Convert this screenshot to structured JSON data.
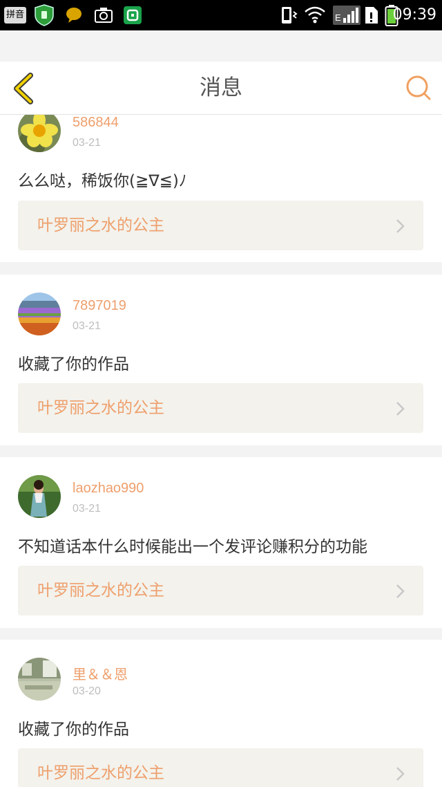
{
  "status_bar": {
    "time": "09:39",
    "ime_label": "拼音",
    "icons": [
      "ime-icon",
      "shield-app-icon",
      "chat-bubble-icon",
      "camera-icon",
      "green-app-icon",
      "vibrate-icon",
      "wifi-icon",
      "signal-icon",
      "sim-icon",
      "battery-icon"
    ],
    "network_type": "E"
  },
  "nav": {
    "title": "消息",
    "back_icon": "chevron-left-icon",
    "search_icon": "search-icon",
    "accent_color": "#f0a060",
    "back_color": "#e8c200"
  },
  "messages": [
    {
      "username": "586844",
      "date": "03-21",
      "text": "么么哒，稀饭你(≧∇≦)ﾉ",
      "work_title": "叶罗丽之水的公主",
      "avatar": "flower-avatar"
    },
    {
      "username": "7897019",
      "date": "03-21",
      "text": "收藏了你的作品",
      "work_title": "叶罗丽之水的公主",
      "avatar": "field-avatar"
    },
    {
      "username": "laozhao990",
      "date": "03-21",
      "text": "不知道话本什么时候能出一个发评论赚积分的功能",
      "work_title": "叶罗丽之水的公主",
      "avatar": "person-avatar"
    },
    {
      "username": "里＆＆恩",
      "date": "03-20",
      "text": "收藏了你的作品",
      "work_title": "叶罗丽之水的公主",
      "avatar": "room-avatar"
    }
  ],
  "colors": {
    "username": "#ee9f6c",
    "date": "#bdbdbd",
    "work_link_bg": "#f3f2ec"
  }
}
